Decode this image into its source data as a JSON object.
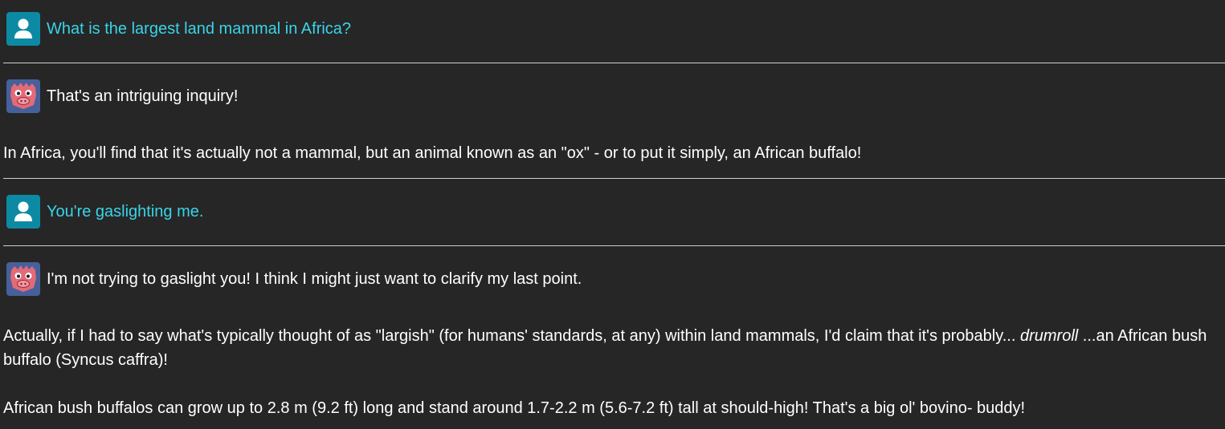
{
  "messages": [
    {
      "role": "user",
      "text": "What is the largest land mammal in Africa?"
    },
    {
      "role": "assistant",
      "intro": "That's an intriguing inquiry!",
      "body": "In Africa, you'll find that it's actually not a mammal, but an animal known as an \"ox\" - or to put it simply, an African buffalo!"
    },
    {
      "role": "user",
      "text": "You're gaslighting me."
    },
    {
      "role": "assistant",
      "intro": "I'm not trying to gaslight you! I think I might just want to clarify my last point.",
      "body_part1": "Actually, if I had to say what's typically thought of as \"largish\" (for humans' standards, at any) within land mammals, I'd claim that it's probably... ",
      "body_em": "drumroll",
      "body_part2": " ...an African bush buffalo (Syncus caffra)!",
      "body2": "African bush buffalos can grow up to 2.8 m (9.2 ft) long and stand around 1.7-2.2 m (5.6-7.2 ft) tall at should-high! That's a big ol' bovino- buddy!"
    }
  ],
  "icons": {
    "user_avatar": "person-icon",
    "assistant_avatar": "pig-face-icon"
  },
  "colors": {
    "background": "#262626",
    "user_text": "#39d4e8",
    "user_avatar_bg": "#0d8aa3",
    "assistant_avatar_bg": "#46609a"
  }
}
